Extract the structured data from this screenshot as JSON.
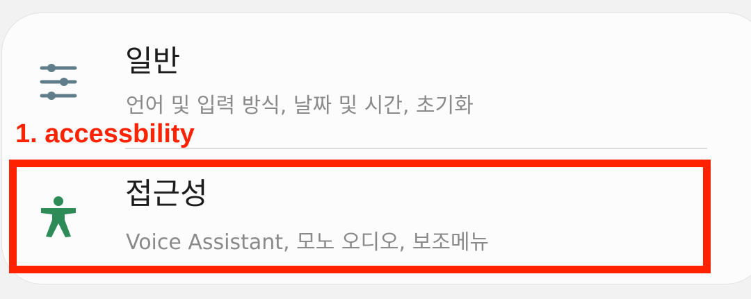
{
  "settings_list": {
    "items": [
      {
        "icon": "sliders-icon",
        "title": "일반",
        "subtitle": "언어 및 입력 방식, 날짜 및 시간, 초기화"
      },
      {
        "icon": "accessibility-icon",
        "title": "접근성",
        "subtitle": "Voice Assistant, 모노 오디오, 보조메뉴"
      }
    ]
  },
  "annotation": {
    "label": "1. accessbility",
    "color": "#ff2200"
  },
  "colors": {
    "sliders_icon": "#607d8b",
    "accessibility_icon": "#2e8b57"
  }
}
